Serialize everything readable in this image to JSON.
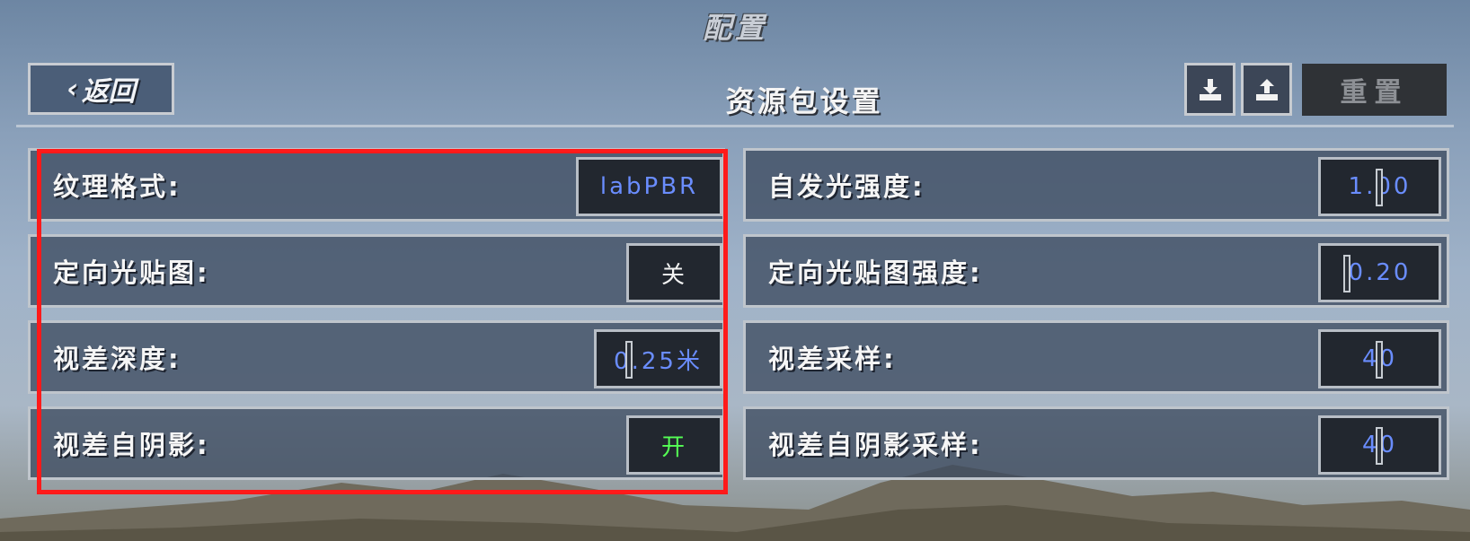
{
  "header": {
    "title": "配置",
    "back_label": "返回",
    "section_title": "资源包设置",
    "reset_label": "重置",
    "download_icon": "download-icon",
    "upload_icon": "upload-icon"
  },
  "left_options": [
    {
      "label": "纹理格式:",
      "value": "labPBR",
      "kind": "select"
    },
    {
      "label": "定向光贴图:",
      "value": "关",
      "kind": "toggle-off"
    },
    {
      "label": "视差深度:",
      "value": "0.25米",
      "kind": "slider",
      "level": 0.25
    },
    {
      "label": "视差自阴影:",
      "value": "开",
      "kind": "toggle-on"
    }
  ],
  "right_options": [
    {
      "label": "自发光强度:",
      "value": "1.00",
      "kind": "slider",
      "level": 0.5
    },
    {
      "label": "定向光贴图强度:",
      "value": "0.20",
      "kind": "slider",
      "level": 0.2
    },
    {
      "label": "视差采样:",
      "value": "40",
      "kind": "slider",
      "level": 0.5
    },
    {
      "label": "视差自阴影采样:",
      "value": "40",
      "kind": "slider",
      "level": 0.5
    }
  ],
  "colors": {
    "value_text": "#6a8dff",
    "on_text": "#55ff55",
    "off_text": "#f3f3f3",
    "highlight": "#ff1a1a"
  }
}
